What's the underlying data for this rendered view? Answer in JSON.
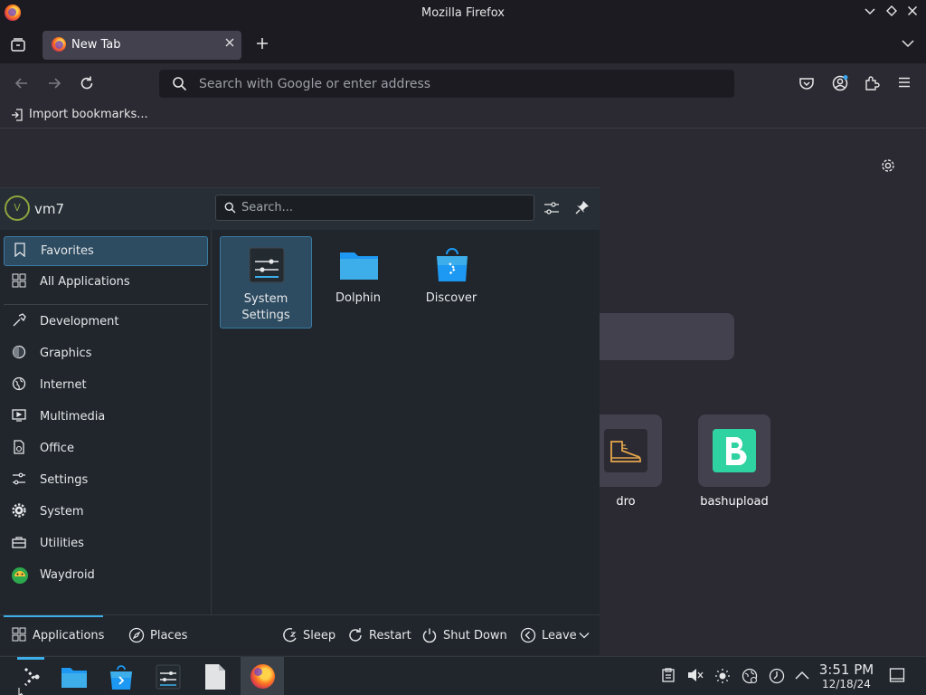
{
  "window": {
    "title": "Mozilla Firefox"
  },
  "tabs": [
    {
      "label": "New Tab"
    }
  ],
  "urlbar": {
    "placeholder": "Search with Google or enter address"
  },
  "bookmarks": {
    "import_label": "Import bookmarks..."
  },
  "newtab": {
    "shortcuts": [
      {
        "label": "dro"
      },
      {
        "label": "bashupload"
      }
    ]
  },
  "launcher": {
    "user": {
      "name": "vm7",
      "avatar_letter": "V"
    },
    "search": {
      "placeholder": "Search..."
    },
    "categories": [
      {
        "label": "Favorites",
        "icon": "bookmark-icon"
      },
      {
        "label": "All Applications",
        "icon": "grid-icon"
      },
      {
        "label": "Development",
        "icon": "hammer-icon"
      },
      {
        "label": "Graphics",
        "icon": "palette-icon"
      },
      {
        "label": "Internet",
        "icon": "globe-icon"
      },
      {
        "label": "Multimedia",
        "icon": "monitor-icon"
      },
      {
        "label": "Office",
        "icon": "document-icon"
      },
      {
        "label": "Settings",
        "icon": "sliders-icon"
      },
      {
        "label": "System",
        "icon": "gear-icon"
      },
      {
        "label": "Utilities",
        "icon": "toolbox-icon"
      },
      {
        "label": "Waydroid",
        "icon": "android-icon"
      }
    ],
    "favorites": [
      {
        "label": "System\nSettings",
        "line1": "System",
        "line2": "Settings"
      },
      {
        "label": "Dolphin"
      },
      {
        "label": "Discover"
      }
    ],
    "footer": {
      "applications": "Applications",
      "places": "Places",
      "sleep": "Sleep",
      "restart": "Restart",
      "shutdown": "Shut Down",
      "leave": "Leave"
    }
  },
  "taskbar": {
    "time": "3:51 PM",
    "date": "12/18/24"
  },
  "colors": {
    "accent": "#3daee9",
    "selection": "#2d4b61",
    "bookmark_green": "#2ed3a1"
  }
}
